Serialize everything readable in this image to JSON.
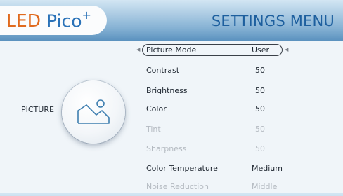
{
  "brand": {
    "part1": "LED",
    "part2": "Pico",
    "sup": "+"
  },
  "header": {
    "title": "SETTINGS MENU"
  },
  "category": {
    "label": "PICTURE",
    "icon": "picture-icon"
  },
  "menu": {
    "items": [
      {
        "label": "Picture Mode",
        "value": "User"
      },
      {
        "label": "Contrast",
        "value": "50"
      },
      {
        "label": "Brightness",
        "value": "50"
      },
      {
        "label": "Color",
        "value": "50"
      },
      {
        "label": "Tint",
        "value": "50"
      },
      {
        "label": "Sharpness",
        "value": "50"
      },
      {
        "label": "Color Temperature",
        "value": "Medium"
      },
      {
        "label": "Noise Reduction",
        "value": "Middle"
      }
    ]
  },
  "colors": {
    "header_blue": "#2d6aa0",
    "brand_orange": "#e06a1e",
    "brand_blue": "#2a72b8",
    "active_text": "#1e2630",
    "disabled_text": "#b4bac1"
  }
}
